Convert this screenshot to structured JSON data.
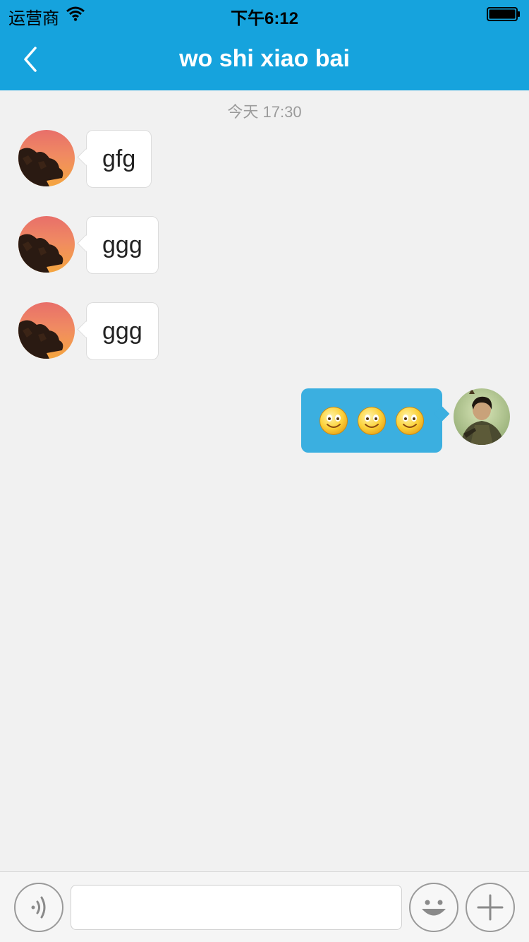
{
  "status_bar": {
    "carrier": "运营商",
    "time": "下午6:12",
    "icons": [
      "wifi-icon",
      "battery-icon"
    ]
  },
  "nav": {
    "title": "wo shi xiao bai",
    "back_icon": "chevron-left-icon"
  },
  "chat": {
    "timestamp": "今天  17:30",
    "incoming": [
      {
        "text": "gfg"
      },
      {
        "text": "ggg"
      },
      {
        "text": "ggg"
      }
    ],
    "outgoing": {
      "emojis": [
        "smiley-icon",
        "smiley-icon",
        "smiley-icon"
      ]
    }
  },
  "input_bar": {
    "value": "",
    "placeholder": "",
    "icons": [
      "voice-icon",
      "emoji-icon",
      "plus-icon"
    ]
  },
  "colors": {
    "nav": "#16a3dd",
    "outgoing_bubble": "#3bafe0",
    "background": "#f1f1f1"
  }
}
